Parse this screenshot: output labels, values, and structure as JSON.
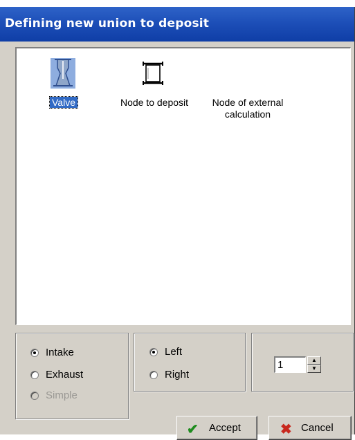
{
  "window": {
    "title": "Defining new union to deposit"
  },
  "items": [
    {
      "label": "Valve",
      "icon": "valve-icon",
      "selected": true
    },
    {
      "label": "Node to deposit",
      "icon": "node-deposit-icon",
      "selected": false
    },
    {
      "label_line1": "Node of external",
      "label_line2": "calculation",
      "icon": "none",
      "selected": false
    }
  ],
  "direction_group": {
    "options": [
      {
        "label": "Intake",
        "checked": true,
        "enabled": true
      },
      {
        "label": "Exhaust",
        "checked": false,
        "enabled": true
      },
      {
        "label": "Simple",
        "checked": false,
        "enabled": false
      }
    ]
  },
  "side_group": {
    "options": [
      {
        "label": "Left",
        "checked": true
      },
      {
        "label": "Right",
        "checked": false
      }
    ]
  },
  "spinner": {
    "value": "1"
  },
  "buttons": {
    "accept": "Accept",
    "cancel": "Cancel"
  },
  "colors": {
    "title_bar": "#1d4fb8",
    "selection": "#316ac5",
    "face": "#d4d0c8",
    "accept_icon": "#1e8c1e",
    "cancel_icon": "#c8281e"
  }
}
